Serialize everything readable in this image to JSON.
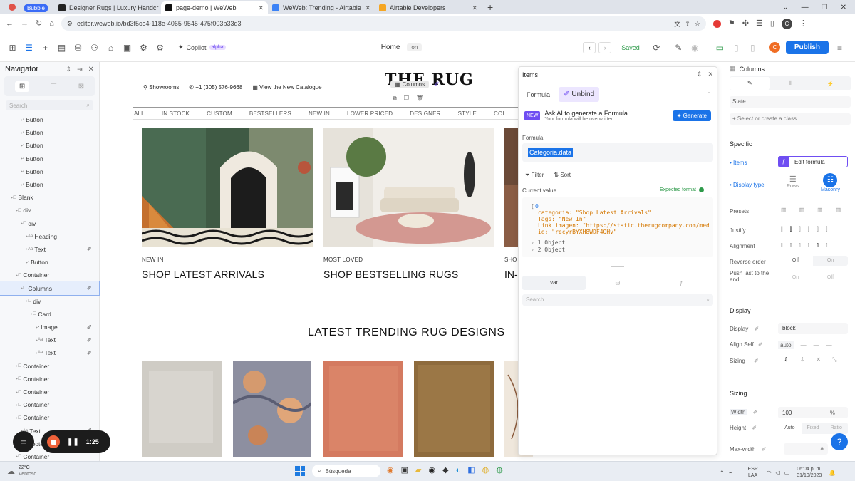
{
  "browser": {
    "tabs": [
      {
        "label": "Bubble",
        "color": "#3b6cf6"
      },
      {
        "label": "Designer Rugs | Luxury Handcr",
        "color": "#222222"
      },
      {
        "label": "page-demo | WeWeb",
        "color": "#1a1a1a"
      },
      {
        "label": "WeWeb: Trending - Airtable",
        "color": "#3b82f6"
      },
      {
        "label": "Airtable Developers",
        "color": "#f5a623"
      }
    ],
    "url": "editor.weweb.io/bd3f5ce4-118e-4065-9545-475f003b33d3",
    "profile_initial": "C"
  },
  "toolbar": {
    "copilot_label": "Copilot",
    "copilot_badge": "alpha",
    "page_label": "Home",
    "page_state": "on",
    "saved_label": "Saved",
    "profile_initial": "C",
    "publish_label": "Publish"
  },
  "navigator": {
    "title": "Navigator",
    "search_placeholder": "Search",
    "tree": [
      {
        "label": "Button",
        "indent": 3
      },
      {
        "label": "Button",
        "indent": 3
      },
      {
        "label": "Button",
        "indent": 3
      },
      {
        "label": "Button",
        "indent": 3
      },
      {
        "label": "Button",
        "indent": 3
      },
      {
        "label": "Button",
        "indent": 3
      },
      {
        "label": "Blank",
        "indent": 1
      },
      {
        "label": "div",
        "indent": 2
      },
      {
        "label": "div",
        "indent": 3
      },
      {
        "label": "Heading",
        "indent": 4
      },
      {
        "label": "Text",
        "indent": 4
      },
      {
        "label": "Button",
        "indent": 4
      },
      {
        "label": "Container",
        "indent": 2
      },
      {
        "label": "Columns",
        "indent": 3
      },
      {
        "label": "div",
        "indent": 4
      },
      {
        "label": "Card",
        "indent": 5
      },
      {
        "label": "Image",
        "indent": 6
      },
      {
        "label": "Text",
        "indent": 6
      },
      {
        "label": "Text",
        "indent": 6
      },
      {
        "label": "Container",
        "indent": 2
      },
      {
        "label": "Container",
        "indent": 2
      },
      {
        "label": "Container",
        "indent": 2
      },
      {
        "label": "Container",
        "indent": 2
      },
      {
        "label": "Container",
        "indent": 2
      },
      {
        "label": "Text",
        "indent": 3
      },
      {
        "label": "Footer",
        "indent": 3
      },
      {
        "label": "Container",
        "indent": 2
      }
    ]
  },
  "site": {
    "showrooms": "Showrooms",
    "phone": "+1 (305) 576-9668",
    "catalogue": "View the New Catalogue",
    "logo": "THE RUG",
    "columns_badge": "Columns",
    "menu": [
      "ALL",
      "IN STOCK",
      "CUSTOM",
      "BESTSELLERS",
      "NEW IN",
      "LOWER PRICED",
      "DESIGNER",
      "STYLE",
      "COL"
    ],
    "cards": [
      {
        "kicker": "NEW IN",
        "title": "SHOP LATEST ARRIVALS"
      },
      {
        "kicker": "MOST LOVED",
        "title": "SHOP BESTSELLING RUGS"
      },
      {
        "kicker": "SHO",
        "title": "IN-"
      }
    ],
    "trending_title": "LATEST TRENDING RUG DESIGNS"
  },
  "items_panel": {
    "title": "Items",
    "tab_formula": "Formula",
    "tab_unbind": "Unbind",
    "new_badge": "NEW",
    "ai_title": "Ask AI to generate a Formula",
    "ai_subtitle": "Your formula will be overwritten",
    "generate": "Generate",
    "formula_label": "Formula",
    "formula_value": "Categoria.data",
    "filter": "Filter",
    "sort": "Sort",
    "current_value": "Current value",
    "expected_format": "Expected format",
    "json_open": "[",
    "json_index0": "0",
    "json_lines": [
      "categoria: \"Shop Latest Arrivals\"",
      "Tags: \"New In\"",
      "Link imagen: \"https://static.therugcompany.com/media/w",
      "id: \"recyrBYXH8WDF4QHv\""
    ],
    "json_more": [
      "1  Object",
      "2  Object"
    ],
    "var_tab": "var",
    "search_placeholder": "Search"
  },
  "properties": {
    "title": "Columns",
    "state": "State",
    "class_placeholder": "Select or create a class",
    "specific": "Specific",
    "items_label": "Items",
    "edit_formula": "Edit formula",
    "display_type": "Display type",
    "rows": "Rows",
    "masonry": "Masonry",
    "presets": "Presets",
    "justify": "Justify",
    "alignment": "Alignment",
    "reverse_order": "Reverse order",
    "reverse_off": "Off",
    "reverse_on": "On",
    "push_last": "Push last to the end",
    "push_on": "On",
    "push_off": "Off",
    "display_section": "Display",
    "display_label": "Display",
    "display_value": "block",
    "align_self": "Align Self",
    "align_self_value": "auto",
    "sizing_label": "Sizing",
    "sizing_section": "Sizing",
    "width_label": "Width",
    "width_value": "100",
    "width_unit": "%",
    "height_label": "Height",
    "height_auto": "Auto",
    "height_fixed": "Fixed",
    "height_ratio": "Ratio",
    "max_width": "Max-width",
    "max_width_unit": "a"
  },
  "recorder": {
    "time": "1:25"
  },
  "taskbar": {
    "temp": "22°C",
    "weather": "Ventoso",
    "search": "Búsqueda",
    "lang1": "ESP",
    "lang2": "LAA",
    "time": "06:04 p. m.",
    "date": "31/10/2023"
  },
  "colors": {
    "accent": "#1a73e8",
    "weweb_purple": "#6f4ef2",
    "publish": "#1a73e8",
    "saved_green": "#2e9a4a"
  }
}
